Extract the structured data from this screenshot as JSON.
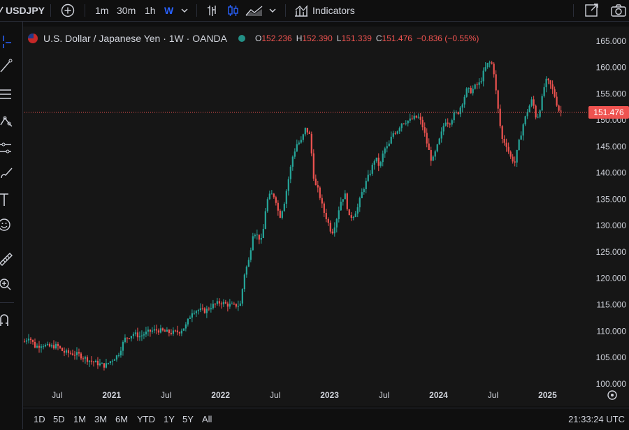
{
  "toolbar": {
    "symbol": "USDJPY",
    "timeframes": [
      "1m",
      "30m",
      "1h",
      "W"
    ],
    "active_timeframe": "W",
    "indicators_label": "Indicators"
  },
  "legend": {
    "title": "U.S. Dollar / Japanese Yen · 1W · OANDA",
    "o_label": "O",
    "o_value": "152.236",
    "h_label": "H",
    "h_value": "152.390",
    "l_label": "L",
    "l_value": "151.339",
    "c_label": "C",
    "c_value": "151.476",
    "change": "−0.836 (−0.55%)"
  },
  "price_tag": "151.476",
  "ranges": [
    "1D",
    "5D",
    "1M",
    "3M",
    "6M",
    "YTD",
    "1Y",
    "5Y",
    "All"
  ],
  "clock": "21:33:24 UTC",
  "colors": {
    "up": "#26a69a",
    "down": "#ef5350",
    "accent": "#2962ff"
  },
  "chart_data": {
    "type": "line",
    "title": "U.S. Dollar / Japanese Yen · 1W · OANDA",
    "ylim": [
      96.0,
      167.5
    ],
    "y_ticks": [
      "100.000",
      "105.000",
      "110.000",
      "115.000",
      "120.000",
      "125.000",
      "130.000",
      "135.000",
      "140.000",
      "145.000",
      "150.000",
      "155.000",
      "160.000",
      "165.000"
    ],
    "x_ticks": [
      {
        "label": "Jul",
        "x": 2020.5
      },
      {
        "label": "2021",
        "x": 2021.0
      },
      {
        "label": "Jul",
        "x": 2021.5
      },
      {
        "label": "2022",
        "x": 2022.0
      },
      {
        "label": "Jul",
        "x": 2022.5
      },
      {
        "label": "2023",
        "x": 2023.0
      },
      {
        "label": "Jul",
        "x": 2023.5
      },
      {
        "label": "2024",
        "x": 2024.0
      },
      {
        "label": "Jul",
        "x": 2024.5
      },
      {
        "label": "2025",
        "x": 2025.0
      }
    ],
    "xlim": [
      2020.2,
      2025.35
    ],
    "last_close": 151.476,
    "series": [
      {
        "x": [
          2020.2,
          2020.24,
          2020.3,
          2020.36,
          2020.42,
          2020.5,
          2020.56,
          2020.62,
          2020.7,
          2020.76,
          2020.82,
          2020.88,
          2020.94,
          2021.0,
          2021.06,
          2021.12,
          2021.2,
          2021.26,
          2021.3,
          2021.36,
          2021.42,
          2021.5,
          2021.56,
          2021.62,
          2021.68,
          2021.74,
          2021.8,
          2021.86,
          2021.92,
          2022.0,
          2022.06,
          2022.12,
          2022.18,
          2022.22,
          2022.26,
          2022.3,
          2022.34,
          2022.38,
          2022.42,
          2022.46,
          2022.5,
          2022.54,
          2022.58,
          2022.62,
          2022.66,
          2022.7,
          2022.74,
          2022.78,
          2022.82,
          2022.86,
          2022.9,
          2022.94,
          2022.98,
          2023.02,
          2023.06,
          2023.1,
          2023.14,
          2023.18,
          2023.22,
          2023.26,
          2023.3,
          2023.34,
          2023.38,
          2023.42,
          2023.46,
          2023.5,
          2023.54,
          2023.58,
          2023.62,
          2023.66,
          2023.7,
          2023.74,
          2023.78,
          2023.82,
          2023.86,
          2023.9,
          2023.94,
          2023.98,
          2024.02,
          2024.06,
          2024.1,
          2024.14,
          2024.18,
          2024.22,
          2024.26,
          2024.3,
          2024.34,
          2024.38,
          2024.42,
          2024.46,
          2024.5,
          2024.54,
          2024.58,
          2024.62,
          2024.66,
          2024.7,
          2024.74,
          2024.78,
          2024.82,
          2024.86,
          2024.9,
          2024.94,
          2024.98,
          2025.02,
          2025.06,
          2025.1,
          2025.14
        ],
        "y": [
          108.0,
          109.0,
          107.0,
          107.5,
          107.0,
          107.2,
          106.0,
          105.8,
          105.5,
          104.8,
          104.2,
          103.8,
          103.4,
          104.5,
          105.5,
          108.5,
          109.5,
          109.0,
          109.5,
          110.0,
          110.2,
          109.8,
          109.7,
          109.9,
          111.0,
          113.8,
          114.0,
          113.8,
          114.8,
          115.5,
          115.0,
          114.8,
          115.0,
          121.0,
          123.5,
          129.0,
          128.0,
          127.0,
          134.5,
          136.0,
          135.5,
          131.5,
          134.0,
          138.5,
          143.0,
          145.5,
          146.0,
          148.5,
          147.0,
          138.0,
          136.5,
          133.0,
          131.0,
          128.5,
          131.0,
          134.5,
          136.0,
          131.5,
          132.0,
          133.5,
          136.5,
          138.5,
          140.5,
          143.0,
          141.0,
          144.5,
          145.0,
          147.5,
          148.0,
          149.5,
          149.8,
          150.0,
          150.5,
          150.5,
          148.5,
          145.0,
          142.0,
          144.5,
          147.0,
          150.0,
          149.5,
          151.0,
          151.5,
          153.5,
          155.8,
          155.5,
          156.5,
          157.0,
          159.5,
          161.0,
          160.5,
          153.0,
          146.5,
          145.5,
          143.0,
          142.0,
          146.0,
          149.5,
          152.0,
          154.0,
          150.0,
          153.0,
          157.5,
          157.0,
          155.0,
          152.0,
          151.476
        ]
      }
    ]
  }
}
